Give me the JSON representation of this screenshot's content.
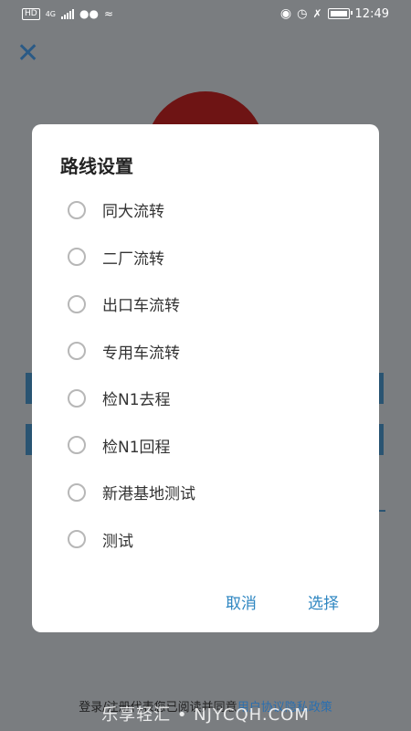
{
  "status_bar": {
    "hd": "HD",
    "network": "4G",
    "time": "12:49",
    "icons": [
      "hd-badge",
      "signal-icon",
      "wechat-icon",
      "wifi-icon",
      "eye-icon",
      "alarm-icon",
      "mute-icon",
      "battery-icon"
    ]
  },
  "background": {
    "close_icon": "close-icon",
    "terms_prefix": "登录/注册代表您已阅读并同意",
    "terms_link": "用户协议隐私政策",
    "watermark": "乐享轻汇 • NJYCQH.COM",
    "logo_color": "#6e1414"
  },
  "dialog": {
    "title": "路线设置",
    "options": [
      {
        "label": "同大流转"
      },
      {
        "label": "二厂流转"
      },
      {
        "label": "出口车流转"
      },
      {
        "label": "专用车流转"
      },
      {
        "label": "检N1去程"
      },
      {
        "label": "检N1回程"
      },
      {
        "label": "新港基地测试"
      },
      {
        "label": "测试"
      }
    ],
    "cancel_label": "取消",
    "select_label": "选择",
    "accent_color": "#2e86c1"
  }
}
